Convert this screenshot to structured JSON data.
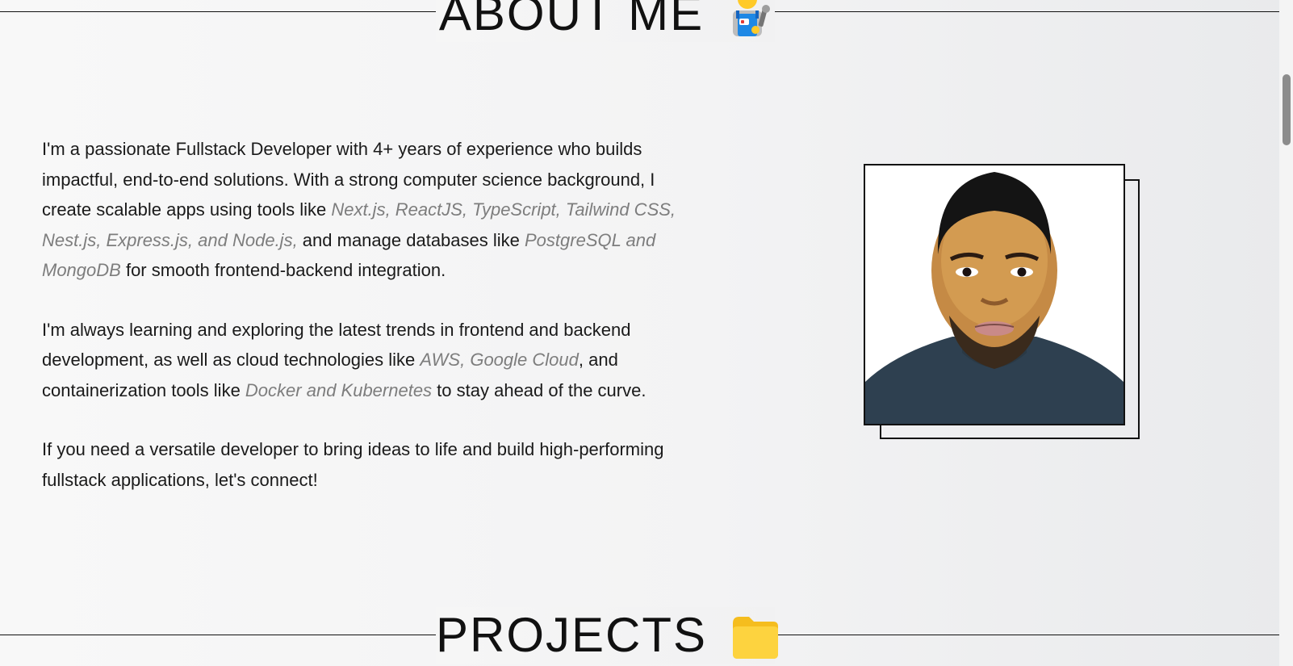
{
  "about": {
    "heading": "ABOUT ME",
    "heading_icon": "mechanic-emoji-icon",
    "paragraphs": [
      [
        {
          "text": "I'm a passionate Fullstack Developer with 4+ years of experience who builds impactful, end-to-end solutions. With a strong computer science background, I create scalable apps using tools like ",
          "style": "normal"
        },
        {
          "text": "Next.js, ReactJS, TypeScript, Tailwind CSS, Nest.js, Express.js, and Node.js,",
          "style": "tech"
        },
        {
          "text": " and manage databases like ",
          "style": "normal"
        },
        {
          "text": "PostgreSQL and MongoDB",
          "style": "tech"
        },
        {
          "text": " for smooth frontend-backend integration.",
          "style": "normal"
        }
      ],
      [
        {
          "text": "I'm always learning and exploring the latest trends in frontend and backend development, as well as cloud technologies like ",
          "style": "normal"
        },
        {
          "text": "AWS, Google Cloud",
          "style": "tech"
        },
        {
          "text": ", and containerization tools like ",
          "style": "normal"
        },
        {
          "text": "Docker and Kubernetes",
          "style": "tech"
        },
        {
          "text": " to stay ahead of the curve.",
          "style": "normal"
        }
      ],
      [
        {
          "text": "If you need a versatile developer to bring ideas to life and build high-performing fullstack applications, let's connect!",
          "style": "normal"
        }
      ]
    ],
    "portrait": "profile-photo"
  },
  "projects": {
    "heading": "PROJECTS",
    "heading_icon": "folder-emoji-icon"
  },
  "colors": {
    "text": "#1a1a1a",
    "tech_highlight": "#7d7d7d",
    "folder": "#fdd33f",
    "rule": "#111111"
  }
}
